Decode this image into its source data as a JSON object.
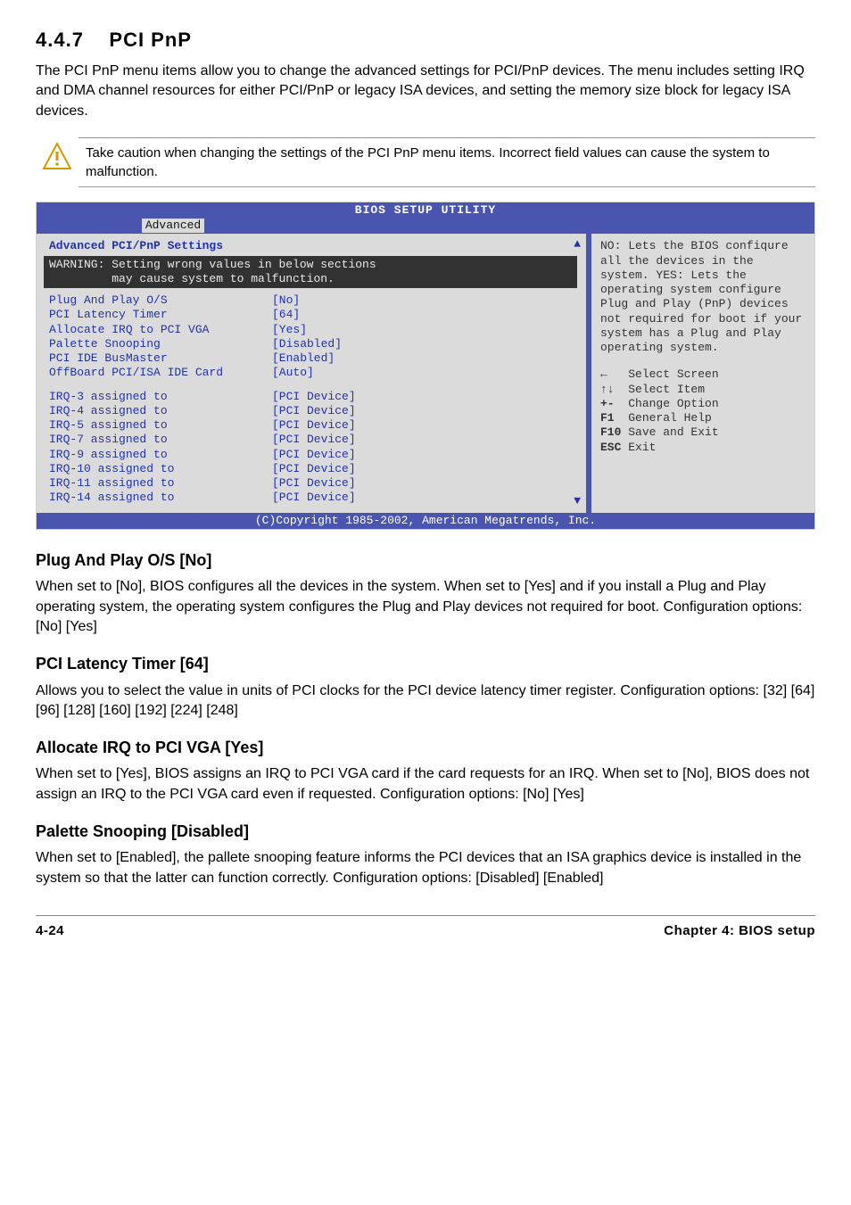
{
  "header": {
    "section_number": "4.4.7",
    "section_title": "PCI PnP"
  },
  "intro": "The PCI PnP menu items allow you to change the advanced settings for PCI/PnP devices. The menu includes setting IRQ and DMA channel resources for either PCI/PnP or legacy ISA devices, and setting the memory size block for legacy ISA devices.",
  "note": "Take caution when changing the settings of the PCI PnP menu items. Incorrect field values can cause the system to malfunction.",
  "bios": {
    "title": "BIOS SETUP UTILITY",
    "tab_active": "Advanced",
    "left_heading": "Advanced PCI/PnP Settings",
    "warning_l1": "WARNING: Setting wrong values in below sections",
    "warning_l2": "         may cause system to malfunction.",
    "options": {
      "r0": {
        "label": "Plug And Play O/S",
        "value": "[No]"
      },
      "r1": {
        "label": "PCI Latency Timer",
        "value": "[64]"
      },
      "r2": {
        "label": "Allocate IRQ to PCI VGA",
        "value": "[Yes]"
      },
      "r3": {
        "label": "Palette Snooping",
        "value": "[Disabled]"
      },
      "r4": {
        "label": "PCI IDE BusMaster",
        "value": "[Enabled]"
      },
      "r5": {
        "label": "OffBoard PCI/ISA IDE Card",
        "value": "[Auto]"
      }
    },
    "irq": {
      "r0": {
        "label": "IRQ-3 assigned to",
        "value": "[PCI Device]"
      },
      "r1": {
        "label": "IRQ-4 assigned to",
        "value": "[PCI Device]"
      },
      "r2": {
        "label": "IRQ-5 assigned to",
        "value": "[PCI Device]"
      },
      "r3": {
        "label": "IRQ-7 assigned to",
        "value": "[PCI Device]"
      },
      "r4": {
        "label": "IRQ-9 assigned to",
        "value": "[PCI Device]"
      },
      "r5": {
        "label": "IRQ-10 assigned to",
        "value": "[PCI Device]"
      },
      "r6": {
        "label": "IRQ-11 assigned to",
        "value": "[PCI Device]"
      },
      "r7": {
        "label": "IRQ-14 assigned to",
        "value": "[PCI Device]"
      }
    },
    "help": "NO: Lets the BIOS confiqure all the devices in the system. YES: Lets the operating system configure Plug and Play (PnP) devices not required for boot if your system has a Plug and Play operating system.",
    "legend": {
      "l0": {
        "k": "←",
        "v": "Select Screen"
      },
      "l1": {
        "k": "↑↓",
        "v": "Select Item"
      },
      "l2": {
        "k": "+-",
        "v": "Change Option"
      },
      "l3": {
        "k": "F1",
        "v": "General Help"
      },
      "l4": {
        "k": "F10",
        "v": "Save and Exit"
      },
      "l5": {
        "k": "ESC",
        "v": "Exit"
      }
    },
    "footer": "(C)Copyright 1985-2002, American Megatrends, Inc."
  },
  "sections": {
    "s0": {
      "heading": "Plug And Play O/S [No]",
      "body": "When set to [No], BIOS configures all the devices in the system. When set to [Yes] and if you install a Plug and Play operating system, the operating system configures the Plug and Play devices not required for boot. Configuration options: [No] [Yes]"
    },
    "s1": {
      "heading": "PCI Latency Timer [64]",
      "body": "Allows you to select the value in units of PCI clocks for the PCI device latency timer register. Configuration options: [32] [64] [96] [128] [160] [192] [224] [248]"
    },
    "s2": {
      "heading": "Allocate IRQ to PCI VGA [Yes]",
      "body": "When set to [Yes], BIOS assigns an IRQ to PCI VGA card if the card requests for an IRQ. When set to [No], BIOS does not assign an IRQ to the PCI VGA card even if requested. Configuration options: [No] [Yes]"
    },
    "s3": {
      "heading": "Palette Snooping [Disabled]",
      "body": "When set to [Enabled], the pallete snooping feature informs the PCI devices that an ISA graphics device is installed in the system so that the latter can function correctly. Configuration options: [Disabled] [Enabled]"
    }
  },
  "footer": {
    "left": "4-24",
    "right": "Chapter 4: BIOS setup"
  }
}
